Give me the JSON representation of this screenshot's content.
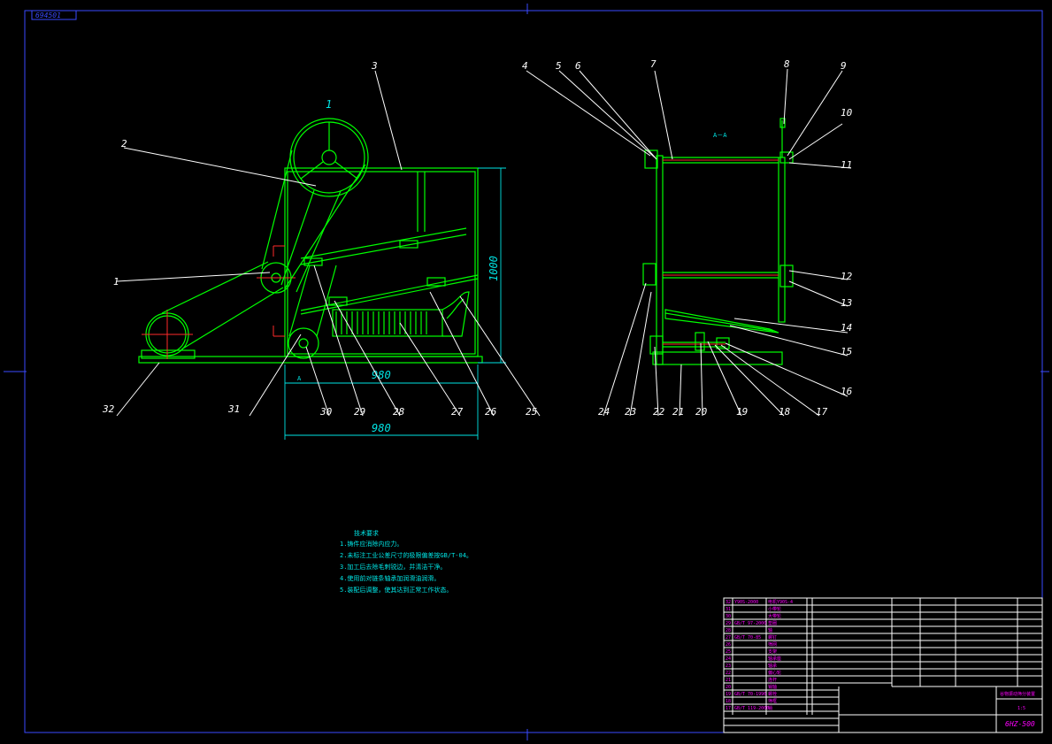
{
  "drawing": {
    "stamp": "694501",
    "view_label_main": "1",
    "section_label": "A－A",
    "section_marker": "A",
    "dim_height": "1000",
    "dim_width_inner": "980",
    "dim_width_outer": "980",
    "drawing_code": "6HZ-500"
  },
  "callouts": [
    "1",
    "2",
    "3",
    "4",
    "5",
    "6",
    "7",
    "8",
    "9",
    "10",
    "11",
    "12",
    "13",
    "14",
    "15",
    "16",
    "17",
    "18",
    "19",
    "20",
    "21",
    "22",
    "23",
    "24",
    "25",
    "26",
    "27",
    "28",
    "29",
    "30",
    "31",
    "32"
  ],
  "tech_notes": {
    "title": "技术要求",
    "lines": [
      "1.铸件应消除内应力。",
      "2.未标注工业公差尺寸的极限偏差按GB/T-04。",
      "3.加工后去除毛刺锐边，并清洁干净。",
      "4.使用前对链条轴承加润滑油润滑。",
      "5.装配后调整，使其达到正常工作状态。"
    ]
  },
  "title_block": {
    "parts_list_rows": [
      [
        "32",
        "Y90S-2000",
        "电机Y90S-4",
        ""
      ],
      [
        "31",
        "",
        "小带轮",
        ""
      ],
      [
        "30",
        "",
        "大带轮",
        ""
      ],
      [
        "29",
        "GB/T 97-2000",
        "垫圈",
        ""
      ],
      [
        "28",
        "",
        "轴",
        ""
      ],
      [
        "27",
        "GB/T 70-85",
        "螺钉",
        ""
      ],
      [
        "26",
        "",
        "筛网",
        ""
      ],
      [
        "25",
        "",
        "支架",
        ""
      ],
      [
        "24",
        "",
        "轴承座",
        ""
      ],
      [
        "23",
        "",
        "轴承",
        ""
      ],
      [
        "22",
        "",
        "偏心轮",
        ""
      ],
      [
        "21",
        "",
        "连杆",
        ""
      ],
      [
        "20",
        "",
        "销轴",
        ""
      ],
      [
        "19",
        "GB/T 70-1996",
        "螺栓",
        ""
      ],
      [
        "18",
        "",
        "筛框",
        ""
      ],
      [
        "17",
        "GB/T 119-2000",
        "销",
        ""
      ],
      [
        "16",
        "",
        "支座",
        ""
      ]
    ],
    "product_name": "谷物振动筛分装置",
    "scale": "1:5"
  },
  "colors": {
    "background": "#000000",
    "frame": "#3a4aff",
    "part_lines": "#00ff00",
    "leaders": "#ffffff",
    "dimensions": "#00e5e5",
    "center_lines": "#ff2a2a",
    "title_block": "#ff00ff"
  }
}
